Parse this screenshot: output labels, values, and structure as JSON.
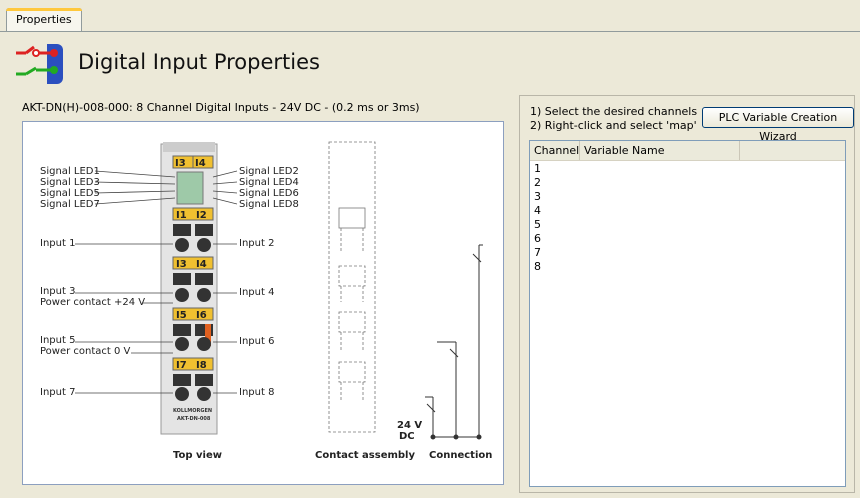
{
  "tabs": [
    {
      "label": "Properties"
    }
  ],
  "header": {
    "title": "Digital Input Properties"
  },
  "module": {
    "description": "AKT-DN(H)-008-000: 8 Channel Digital Inputs - 24V DC - (0.2 ms or 3ms)"
  },
  "diagram": {
    "left_labels": [
      "Signal LED1",
      "Signal LED3",
      "Signal LED5",
      "Signal LED7",
      "Input 1",
      "Input 3",
      "Power contact +24 V",
      "Input 5",
      "Power contact 0 V",
      "Input 7"
    ],
    "right_labels": [
      "Signal LED2",
      "Signal LED4",
      "Signal LED6",
      "Signal LED8",
      "Input 2",
      "Input 4",
      "Input 6",
      "Input 8"
    ],
    "terminal_labels": [
      "I3",
      "I4",
      "I1",
      "I2",
      "I3",
      "I4",
      "I5",
      "I6",
      "I7",
      "I8"
    ],
    "brand": "KOLLMORGEN",
    "model": "AKT-DN-008",
    "captions": [
      "Top view",
      "Contact assembly",
      "Connection"
    ],
    "supply_label": [
      "24 V",
      "DC"
    ]
  },
  "instructions": [
    "1) Select the desired channels",
    "2) Right-click and select 'map'"
  ],
  "wizard_button": {
    "label": "PLC Variable Creation Wizard"
  },
  "table": {
    "columns": [
      "Channel",
      "Variable Name"
    ],
    "rows": [
      "1",
      "2",
      "3",
      "4",
      "5",
      "6",
      "7",
      "8"
    ]
  }
}
